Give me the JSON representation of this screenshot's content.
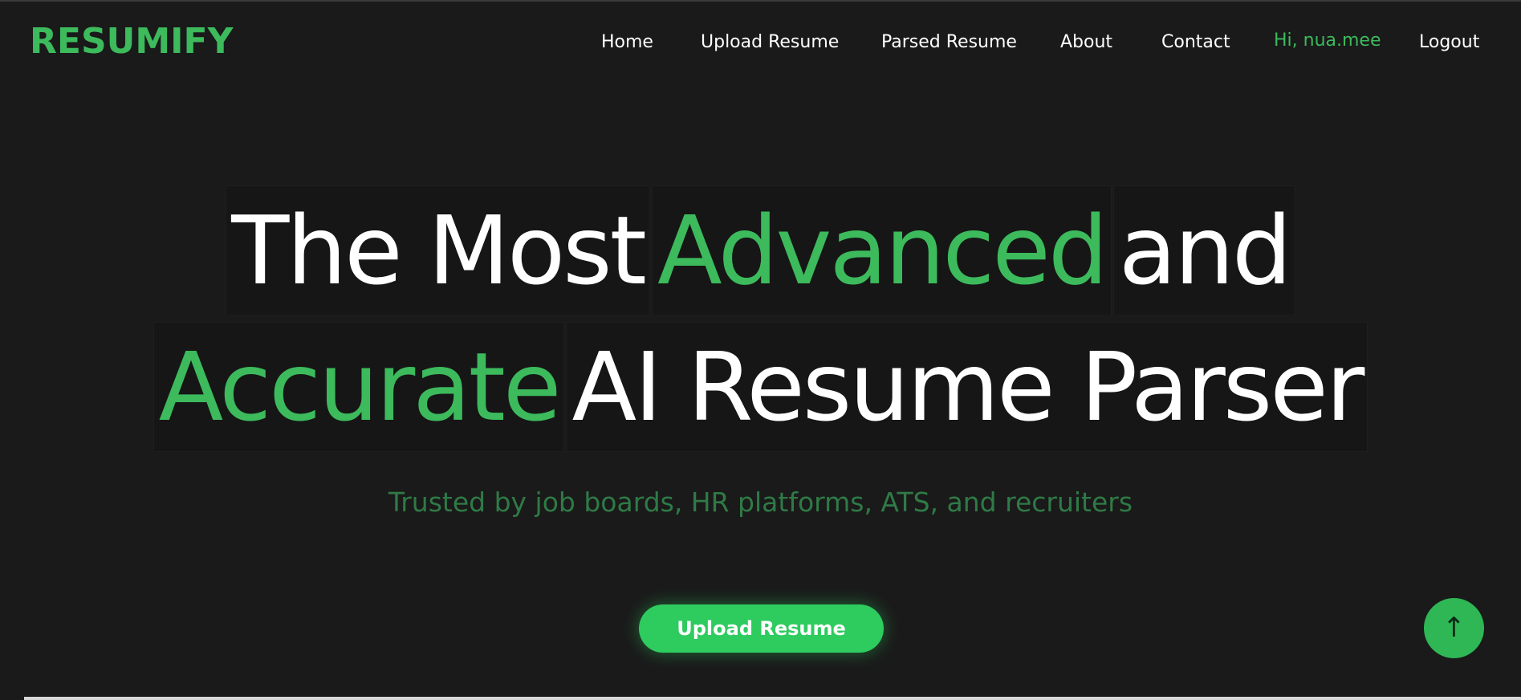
{
  "navbar": {
    "logo": "RESUMIFY",
    "links": {
      "home": "Home",
      "upload": "Upload Resume",
      "parsed": "Parsed Resume",
      "about": "About",
      "contact": "Contact"
    },
    "user_greeting": "Hi, nua.mee",
    "logout": "Logout"
  },
  "hero": {
    "line1": {
      "w1": "The Most",
      "w2": "Advanced",
      "w3": "and"
    },
    "line2": {
      "w1": "Accurate",
      "w2": "AI Resume Parser"
    },
    "subtitle": "Trusted by job boards, HR platforms, ATS, and recruiters",
    "cta": "Upload Resume"
  },
  "scroll_top": {
    "icon": "arrow-up-icon",
    "glyph": "↑"
  },
  "colors": {
    "background": "#1a1a1a",
    "accent": "#3cba5c",
    "button": "#2ecb5f",
    "subtitle": "#2f7a46"
  }
}
